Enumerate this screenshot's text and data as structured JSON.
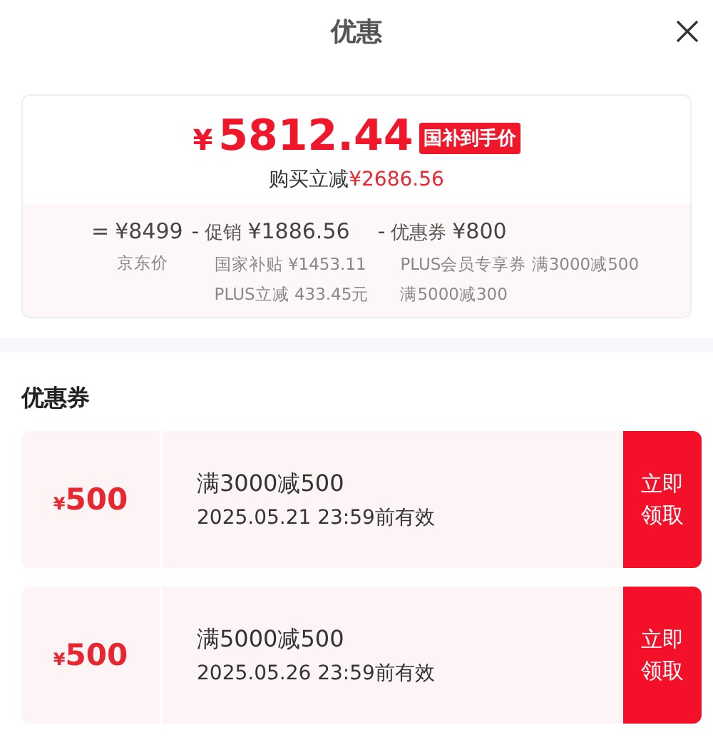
{
  "header": {
    "title": "优惠"
  },
  "summary": {
    "currency": "¥",
    "price": "5812.44",
    "badge": "国补到手价",
    "saving_label": "购买立减",
    "saving": "¥2686.56"
  },
  "breakdown": [
    {
      "op": "=",
      "amount": "¥8499",
      "notes": [
        "京东价"
      ]
    },
    {
      "op": "-",
      "label": "促销",
      "amount": "¥1886.56",
      "notes": [
        "国家补贴 ¥1453.11",
        "PLUS立减 433.45元"
      ]
    },
    {
      "op": "-",
      "label": "优惠券",
      "amount": "¥800",
      "notes": [
        "PLUS会员专享券 满3000减500",
        "满5000减300"
      ]
    }
  ],
  "coupons_title": "优惠券",
  "coupons": [
    {
      "currency": "¥",
      "amount": "500",
      "condition": "满3000减500",
      "expiry": "2025.05.21 23:59前有效",
      "action": "立即领取"
    },
    {
      "currency": "¥",
      "amount": "500",
      "condition": "满5000减500",
      "expiry": "2025.05.26 23:59前有效",
      "action": "立即领取"
    }
  ]
}
